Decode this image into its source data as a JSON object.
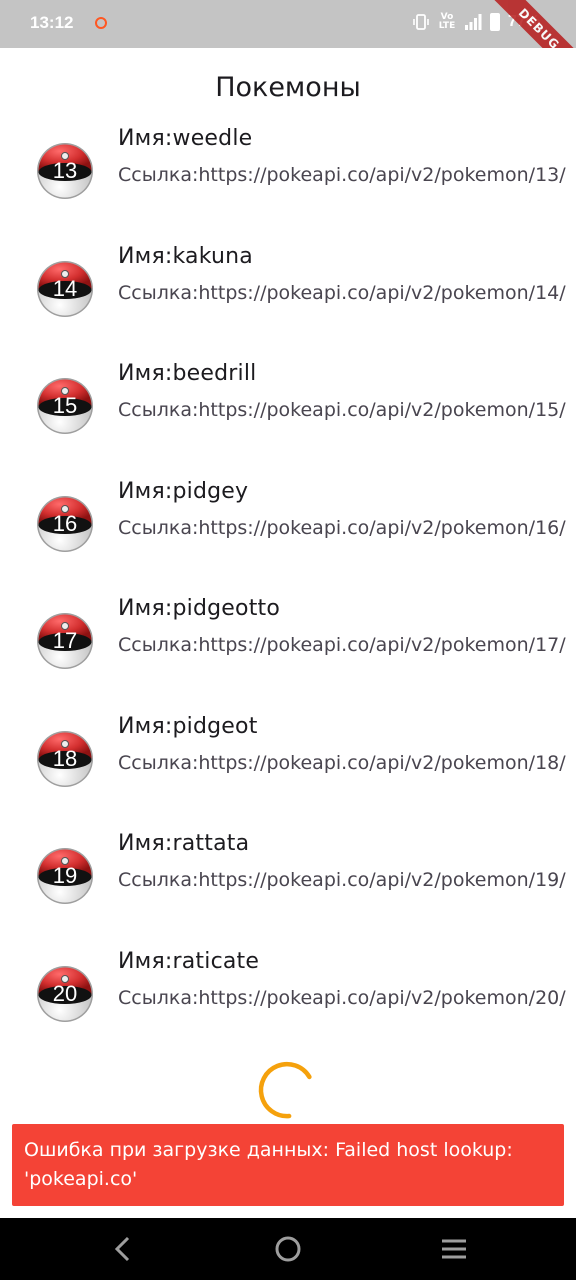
{
  "status_bar": {
    "time": "13:12",
    "lte_label": "Vo LTE",
    "battery": "77%"
  },
  "debug_banner": "DEBUG",
  "app_bar": {
    "title": "Покемоны"
  },
  "pokemon": [
    {
      "number": "13",
      "name": "Имя:weedle",
      "link": "Ссылка:https://pokeapi.co/api/v2/pokemon/13/"
    },
    {
      "number": "14",
      "name": "Имя:kakuna",
      "link": "Ссылка:https://pokeapi.co/api/v2/pokemon/14/"
    },
    {
      "number": "15",
      "name": "Имя:beedrill",
      "link": "Ссылка:https://pokeapi.co/api/v2/pokemon/15/"
    },
    {
      "number": "16",
      "name": "Имя:pidgey",
      "link": "Ссылка:https://pokeapi.co/api/v2/pokemon/16/"
    },
    {
      "number": "17",
      "name": "Имя:pidgeotto",
      "link": "Ссылка:https://pokeapi.co/api/v2/pokemon/17/"
    },
    {
      "number": "18",
      "name": "Имя:pidgeot",
      "link": "Ссылка:https://pokeapi.co/api/v2/pokemon/18/"
    },
    {
      "number": "19",
      "name": "Имя:rattata",
      "link": "Ссылка:https://pokeapi.co/api/v2/pokemon/19/"
    },
    {
      "number": "20",
      "name": "Имя:raticate",
      "link": "Ссылка:https://pokeapi.co/api/v2/pokemon/20/"
    }
  ],
  "snackbar": {
    "message": "Ошибка при загрузке данных: Failed host lookup: 'pokeapi.co'",
    "color": "#f44336"
  },
  "icons": {
    "list_avatar": "pokeball-icon",
    "loading": "loading-spinner",
    "nav": [
      "back-icon",
      "home-icon",
      "recents-icon"
    ]
  },
  "colors": {
    "spinner": "#f5a10c",
    "pokeball_red": "#d32f2f",
    "nav_background": "#000000"
  }
}
